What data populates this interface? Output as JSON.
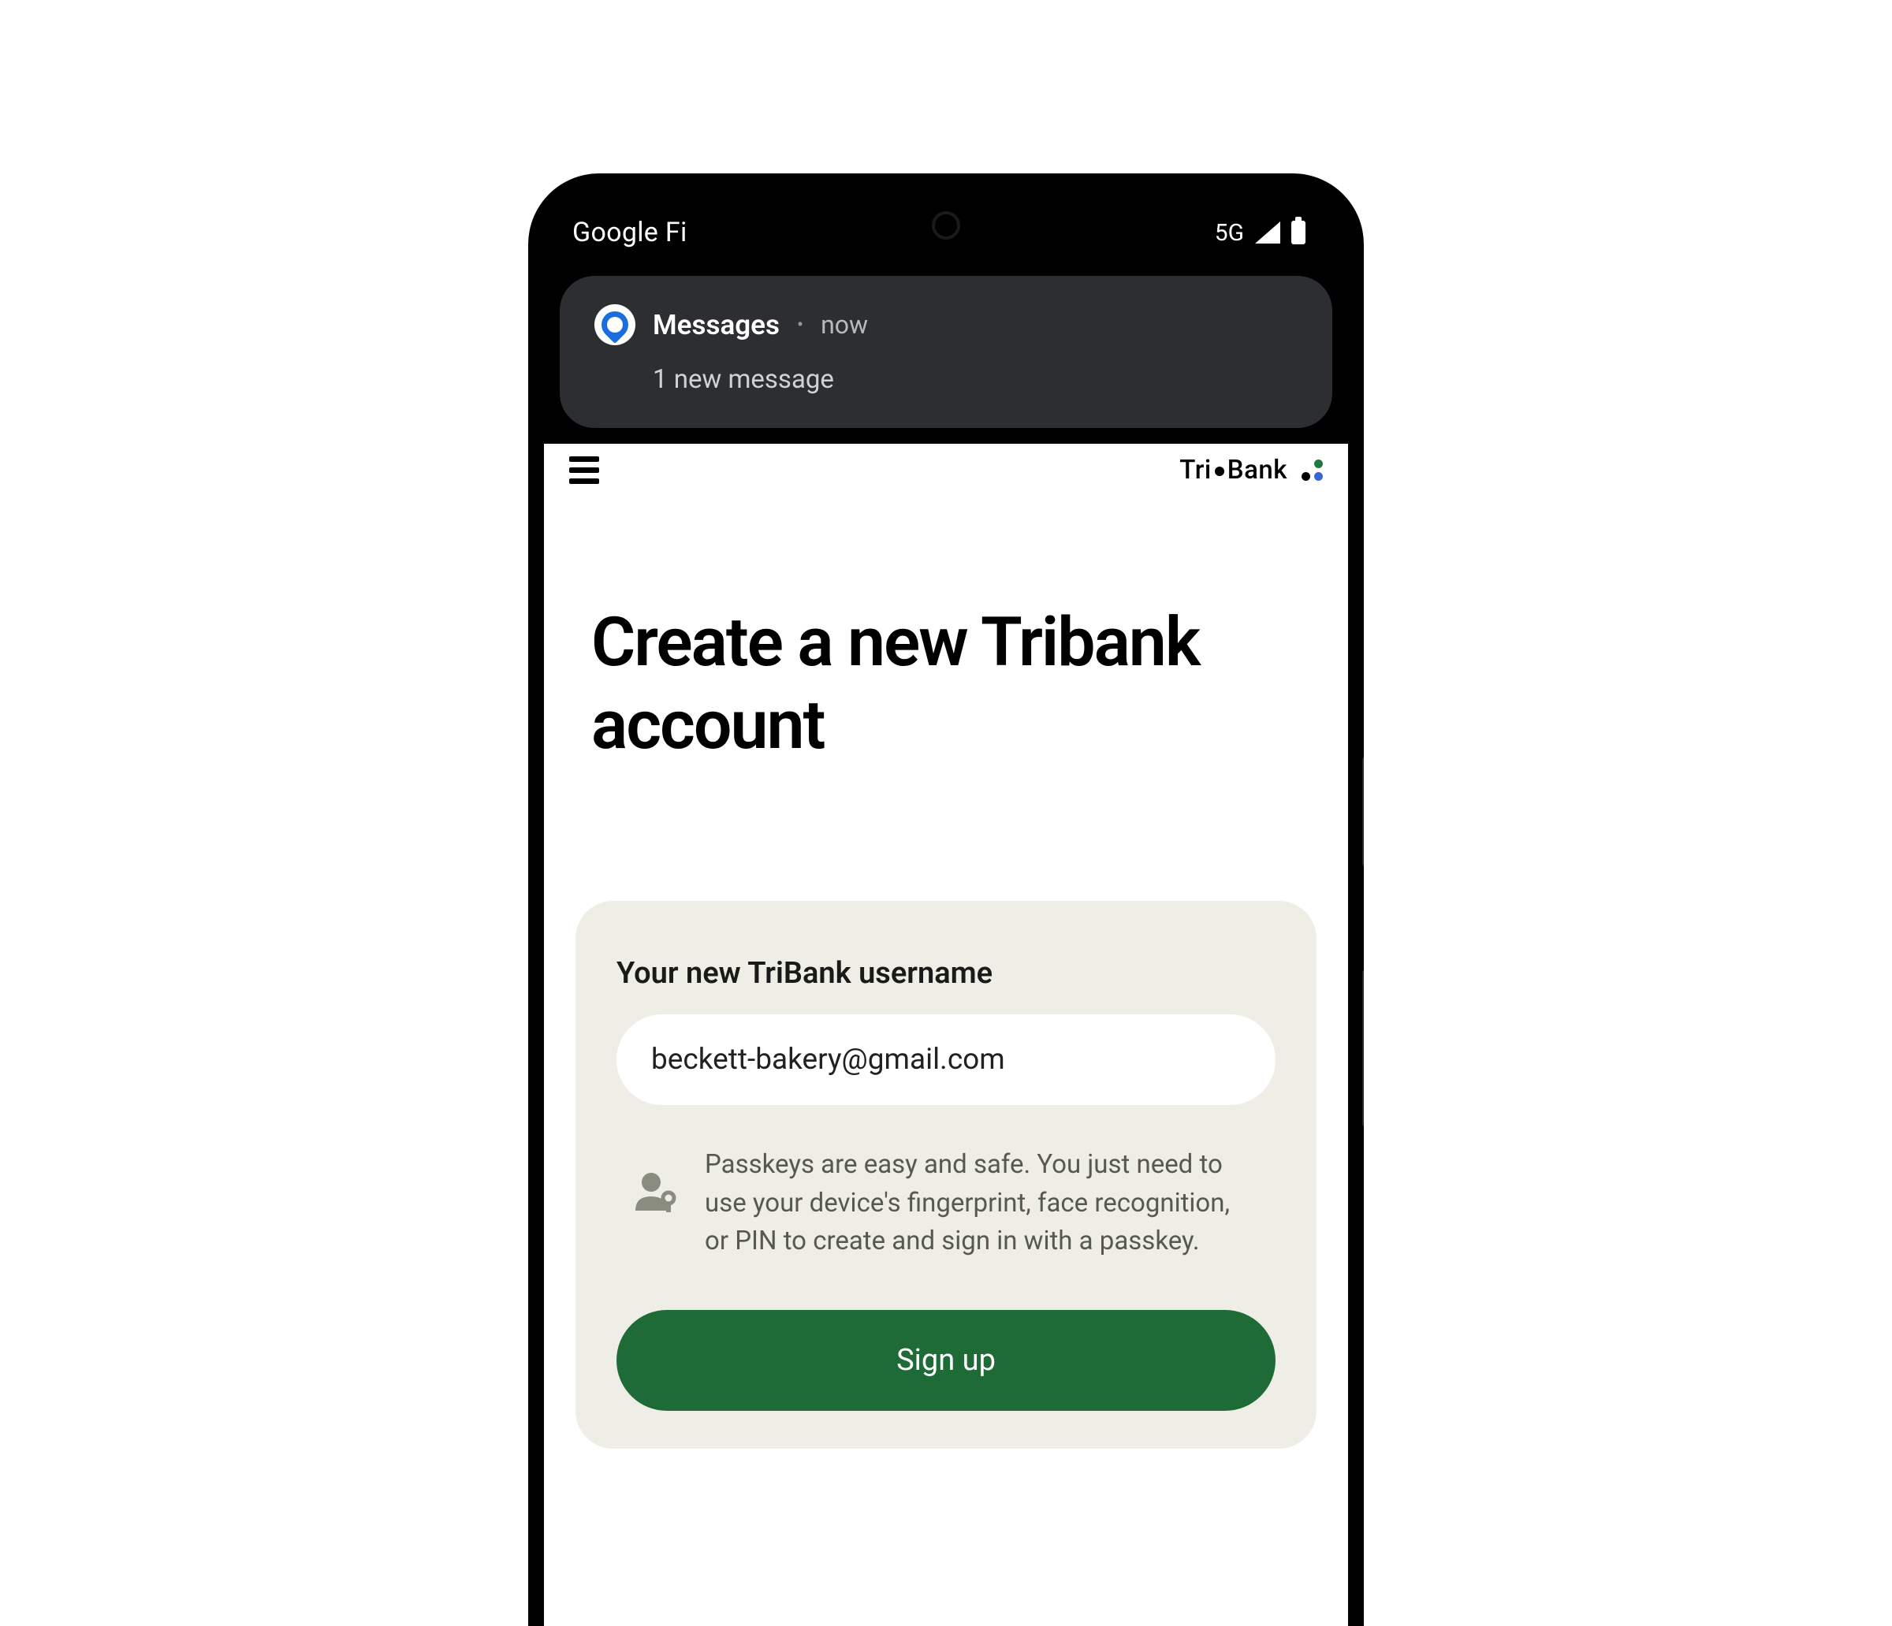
{
  "status_bar": {
    "carrier": "Google Fi",
    "network": "5G"
  },
  "notification": {
    "app_name": "Messages",
    "time": "now",
    "body": "1 new message"
  },
  "app_header": {
    "brand_part1": "Tri",
    "brand_part2": "Bank"
  },
  "main": {
    "heading": "Create a new Tribank account"
  },
  "form": {
    "username_label": "Your new TriBank username",
    "username_value": "beckett-bakery@gmail.com",
    "passkey_info": "Passkeys are easy and safe. You just need to use your device's fingerprint, face recognition, or PIN to create and sign in with a passkey.",
    "signup_label": "Sign up"
  }
}
